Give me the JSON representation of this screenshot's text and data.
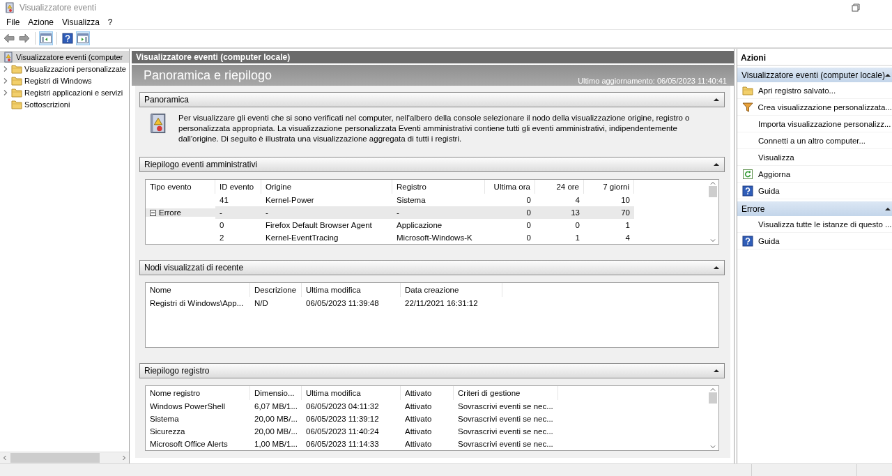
{
  "window": {
    "title": "Visualizzatore eventi"
  },
  "menu": [
    {
      "label": "File"
    },
    {
      "label": "Azione"
    },
    {
      "label": "Visualizza"
    },
    {
      "label": "?"
    }
  ],
  "toolbar": [
    {
      "kind": "back",
      "pressed": false
    },
    {
      "kind": "forward",
      "pressed": false
    },
    {
      "kind": "console-tree",
      "pressed": true
    },
    {
      "kind": "help",
      "pressed": false
    },
    {
      "kind": "action-pane",
      "pressed": true
    }
  ],
  "tree": {
    "items": [
      {
        "label": "Visualizzatore eventi (computer",
        "selected": true,
        "children": [
          {
            "label": "Visualizzazioni personalizzate",
            "selected": false,
            "expanded": false
          },
          {
            "label": "Registri di Windows",
            "selected": false,
            "expanded": false
          },
          {
            "label": "Registri applicazioni e servizi",
            "selected": false,
            "expanded": false
          },
          {
            "label": "Sottoscrizioni",
            "selected": false
          }
        ]
      }
    ]
  },
  "main": {
    "header": "Visualizzatore eventi (computer locale)",
    "title": "Panoramica e riepilogo",
    "last_updated": "Ultimo aggiornamento: 06/05/2023 11:40:41",
    "sections": [
      {
        "kind": "text",
        "title": "Panoramica",
        "expanded": true,
        "text": "Per visualizzare gli eventi che si sono verificati nel computer, nell'albero della console selezionare il nodo della visualizzazione origine, registro o personalizzata appropriata. La visualizzazione personalizzata Eventi amministrativi contiene tutti gli eventi amministrativi, indipendentemente dall'origine. Di seguito è illustrata una visualizzazione aggregata di tutti i registri."
      },
      {
        "kind": "event-table",
        "title": "Riepilogo eventi amministrativi",
        "expanded": true,
        "columns": [
          "Tipo evento",
          "ID evento",
          "Origine",
          "Registro",
          "Ultima ora",
          "24 ore",
          "7 giorni"
        ],
        "rows": [
          {
            "kind": "event",
            "cells": [
              "",
              "41",
              "Kernel-Power",
              "Sistema",
              "0",
              "4",
              "10"
            ]
          },
          {
            "kind": "group",
            "expanded": true,
            "cells": [
              "Errore",
              "-",
              "-",
              "-",
              "0",
              "13",
              "70"
            ]
          },
          {
            "kind": "event",
            "cells": [
              "",
              "0",
              "Firefox Default Browser Agent",
              "Applicazione",
              "0",
              "0",
              "1"
            ]
          },
          {
            "kind": "event",
            "cells": [
              "",
              "2",
              "Kernel-EventTracing",
              "Microsoft-Windows-K",
              "0",
              "1",
              "4"
            ]
          }
        ]
      },
      {
        "kind": "table",
        "title": "Nodi visualizzati di recente",
        "expanded": true,
        "columns": [
          "Nome",
          "Descrizione",
          "Ultima modifica",
          "Data creazione"
        ],
        "rows": [
          {
            "cells": [
              "Registri di Windows\\App...",
              "N/D",
              "06/05/2023 11:39:48",
              "22/11/2021 16:31:12"
            ]
          }
        ]
      },
      {
        "kind": "table",
        "title": "Riepilogo registro",
        "expanded": true,
        "columns": [
          "Nome registro",
          "Dimensio...",
          "Ultima modifica",
          "Attivato",
          "Criteri di gestione"
        ],
        "rows": [
          {
            "cells": [
              "Windows PowerShell",
              "6,07 MB/1...",
              "06/05/2023 04:11:32",
              "Attivato",
              "Sovrascrivi eventi se nec..."
            ]
          },
          {
            "cells": [
              "Sistema",
              "20,00 MB/...",
              "06/05/2023 11:39:12",
              "Attivato",
              "Sovrascrivi eventi se nec..."
            ]
          },
          {
            "cells": [
              "Sicurezza",
              "20,00 MB/...",
              "06/05/2023 11:40:24",
              "Attivato",
              "Sovrascrivi eventi se nec..."
            ]
          },
          {
            "cells": [
              "Microsoft Office Alerts",
              "1,00 MB/1...",
              "06/05/2023 11:14:33",
              "Attivato",
              "Sovrascrivi eventi se nec..."
            ]
          }
        ]
      }
    ]
  },
  "actions": {
    "title": "Azioni",
    "sections": [
      {
        "title": "Visualizzatore eventi (computer locale)",
        "expanded": true,
        "items": [
          {
            "label": "Apri registro salvato...",
            "kind": "folder"
          },
          {
            "label": "Crea visualizzazione personalizzata...",
            "kind": "filter"
          },
          {
            "label": "Importa visualizzazione personalizz...",
            "kind": "plain"
          },
          {
            "label": "Connetti a un altro computer...",
            "kind": "plain"
          },
          {
            "label": "Visualizza",
            "kind": "plain"
          },
          {
            "label": "Aggiorna",
            "kind": "refresh"
          },
          {
            "label": "Guida",
            "kind": "help"
          }
        ]
      },
      {
        "title": "Errore",
        "expanded": true,
        "items": [
          {
            "label": "Visualizza tutte le istanze di questo ...",
            "kind": "plain"
          },
          {
            "label": "Guida",
            "kind": "help"
          }
        ]
      }
    ]
  }
}
